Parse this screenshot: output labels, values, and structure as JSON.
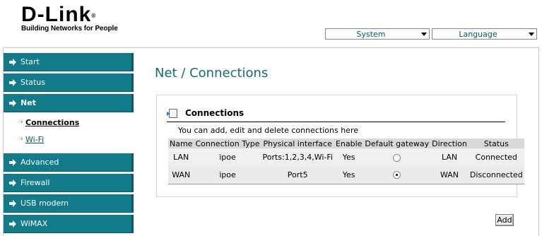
{
  "logo": {
    "brand": "D-Link",
    "reg": "®",
    "tagline": "Building Networks for People"
  },
  "top_menus": {
    "system": "System",
    "language": "Language"
  },
  "sidebar": {
    "items": [
      {
        "label": "Start",
        "icon": "arrow-right-icon"
      },
      {
        "label": "Status",
        "icon": "arrow-right-icon"
      },
      {
        "label": "Net",
        "icon": "arrow-right-icon",
        "active": true
      },
      {
        "label": "Advanced",
        "icon": "arrow-right-icon"
      },
      {
        "label": "Firewall",
        "icon": "arrow-right-icon"
      },
      {
        "label": "USB modem",
        "icon": "arrow-right-icon"
      },
      {
        "label": "WiMAX",
        "icon": "arrow-right-icon"
      }
    ],
    "subitems": [
      {
        "label": "Connections",
        "current": true
      },
      {
        "label": "Wi-Fi"
      }
    ]
  },
  "page_title": "Net / Connections",
  "panel": {
    "title": "Connections",
    "description": "You can add, edit and delete connections here",
    "columns": [
      "Name",
      "Connection Type",
      "Physical interface",
      "Enable",
      "Default gateway",
      "Direction",
      "Status"
    ],
    "rows": [
      {
        "name": "LAN",
        "type": "ipoe",
        "iface": "Ports:1,2,3,4,Wi-Fi",
        "enable": "Yes",
        "gateway_selected": false,
        "direction": "LAN",
        "status": "Connected"
      },
      {
        "name": "WAN",
        "type": "ipoe",
        "iface": "Port5",
        "enable": "Yes",
        "gateway_selected": true,
        "direction": "WAN",
        "status": "Disconnected"
      }
    ]
  },
  "buttons": {
    "add": "Add"
  },
  "colors": {
    "nav_bg": "#127b89",
    "title": "#146c78"
  }
}
